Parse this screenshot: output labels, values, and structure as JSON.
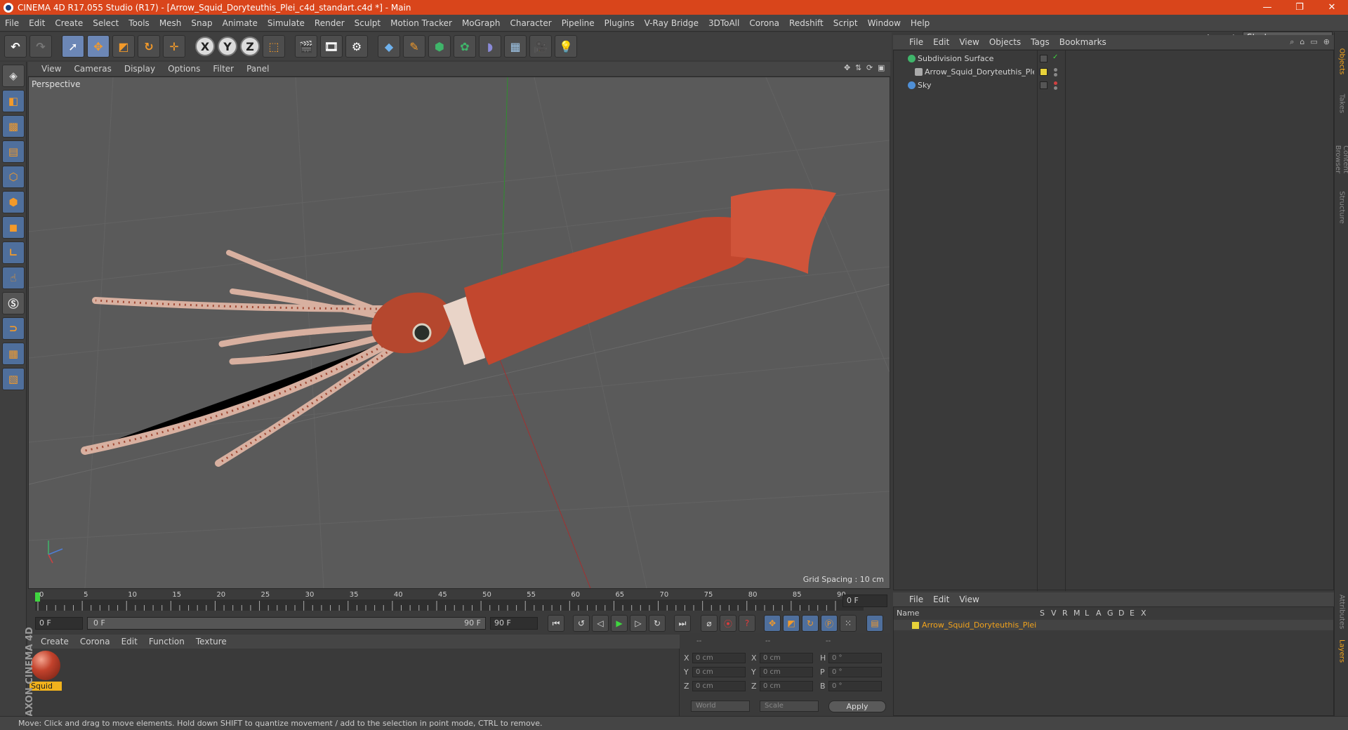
{
  "window": {
    "title": "CINEMA 4D R17.055 Studio (R17) - [Arrow_Squid_Doryteuthis_Plei_c4d_standart.c4d *] - Main",
    "controls": [
      "—",
      "❐",
      "✕"
    ]
  },
  "menubar": {
    "items": [
      "File",
      "Edit",
      "Create",
      "Select",
      "Tools",
      "Mesh",
      "Snap",
      "Animate",
      "Simulate",
      "Render",
      "Sculpt",
      "Motion Tracker",
      "MoGraph",
      "Character",
      "Pipeline",
      "Plugins",
      "V-Ray Bridge",
      "3DToAll",
      "Corona",
      "Redshift",
      "Script",
      "Window",
      "Help"
    ],
    "layout_label": "Layout:",
    "layout_value": "Startup"
  },
  "toolbar": {
    "axis_x": "X",
    "axis_y": "Y",
    "axis_z": "Z"
  },
  "viewport": {
    "menu": [
      "View",
      "Cameras",
      "Display",
      "Options",
      "Filter",
      "Panel"
    ],
    "label": "Perspective",
    "grid_spacing": "Grid Spacing : 10 cm"
  },
  "timeline": {
    "ticks": [
      "0",
      "5",
      "10",
      "15",
      "20",
      "25",
      "30",
      "35",
      "40",
      "45",
      "50",
      "55",
      "60",
      "65",
      "70",
      "75",
      "80",
      "85",
      "90"
    ],
    "current_frame": "0 F",
    "start_field": "0 F",
    "range_start": "0 F",
    "range_end": "90 F",
    "end_field": "90 F"
  },
  "material_manager": {
    "menu": [
      "Create",
      "Corona",
      "Edit",
      "Function",
      "Texture"
    ],
    "material_name": "Squid"
  },
  "coordinates": {
    "header_pos": "--",
    "header_size": "--",
    "header_rot": "--",
    "labels": [
      "X",
      "Y",
      "Z",
      "X",
      "Y",
      "Z",
      "H",
      "P",
      "B"
    ],
    "pos_values": [
      "0 cm",
      "0 cm",
      "0 cm"
    ],
    "size_values": [
      "0 cm",
      "0 cm",
      "0 cm"
    ],
    "rot_values": [
      "0 °",
      "0 °",
      "0 °"
    ],
    "world_dropdown": "World",
    "scale_dropdown": "Scale",
    "apply_label": "Apply"
  },
  "object_manager": {
    "menu": [
      "File",
      "Edit",
      "View",
      "Objects",
      "Tags",
      "Bookmarks"
    ],
    "objects": [
      {
        "name": "Subdivision Surface",
        "icon_color": "#3fb56a"
      },
      {
        "name": "Arrow_Squid_Doryteuthis_Plei",
        "icon_color": "#aaaaaa"
      },
      {
        "name": "Sky",
        "icon_color": "#4f8fd6"
      }
    ]
  },
  "side_tabs": [
    "Objects",
    "Takes",
    "Content Browser",
    "Structure",
    "Attributes",
    "Layers"
  ],
  "layer_manager": {
    "menu": [
      "File",
      "Edit",
      "View"
    ],
    "col_name": "Name",
    "columns": [
      "S",
      "V",
      "R",
      "M",
      "L",
      "A",
      "G",
      "D",
      "E",
      "X"
    ],
    "layer_name": "Arrow_Squid_Doryteuthis_Plei"
  },
  "status": {
    "message": "Move: Click and drag to move elements. Hold down SHIFT to quantize movement / add to the selection in point mode, CTRL to remove."
  },
  "branding": {
    "logo_text": "MAXON CINEMA 4D"
  },
  "colors": {
    "title_bar": "#d9451b",
    "accent_orange": "#f2a31c",
    "tool_blue": "#4f6f9c",
    "squid_red": "#c2422c"
  }
}
